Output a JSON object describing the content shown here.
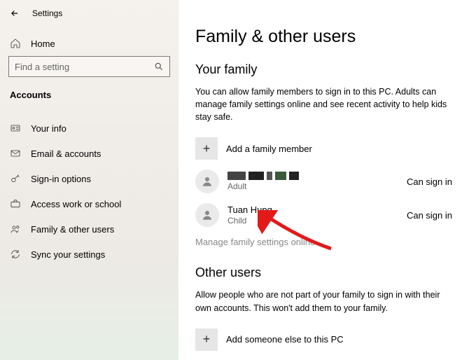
{
  "app_title": "Settings",
  "sidebar": {
    "home": "Home",
    "search_placeholder": "Find a setting",
    "section": "Accounts",
    "items": [
      {
        "label": "Your info"
      },
      {
        "label": "Email & accounts"
      },
      {
        "label": "Sign-in options"
      },
      {
        "label": "Access work or school"
      },
      {
        "label": "Family & other users"
      },
      {
        "label": "Sync your settings"
      }
    ]
  },
  "main": {
    "title": "Family & other users",
    "family": {
      "header": "Your family",
      "desc": "You can allow family members to sign in to this PC. Adults can manage family settings online and see recent activity to help kids stay safe.",
      "add_label": "Add a family member",
      "members": [
        {
          "name": "",
          "role": "Adult",
          "status": "Can sign in",
          "redacted": true
        },
        {
          "name": "Tuan Hung",
          "role": "Child",
          "status": "Can sign in",
          "redacted": false
        }
      ],
      "manage_link": "Manage family settings online"
    },
    "other": {
      "header": "Other users",
      "desc": "Allow people who are not part of your family to sign in with their own accounts. This won't add them to your family.",
      "add_label": "Add someone else to this PC"
    }
  }
}
